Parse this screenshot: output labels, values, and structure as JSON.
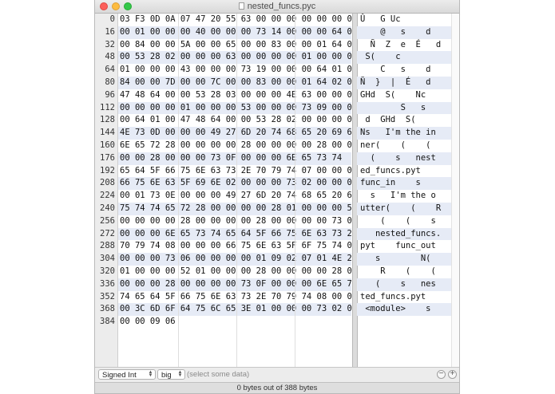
{
  "window": {
    "title": "nested_funcs.pyc"
  },
  "offsets": [
    "0",
    "16",
    "32",
    "48",
    "64",
    "80",
    "96",
    "112",
    "128",
    "144",
    "160",
    "176",
    "192",
    "208",
    "224",
    "240",
    "256",
    "272",
    "288",
    "304",
    "320",
    "336",
    "352",
    "368",
    "384"
  ],
  "hex_rows": [
    "03 F3 0D 0A 07 47 20 55 63 00 00 00 00 00 00 00",
    "00 01 00 00 00 40 00 00 00 73 14 00 00 00 64 00",
    "00 84 00 00 5A 00 00 65 00 00 83 00 00 01 64 01",
    "00 53 28 02 00 00 00 63 00 00 00 00 01 00 00 00",
    "01 00 00 00 43 00 00 00 73 19 00 00 00 64 01 00",
    "84 00 00 7D 00 00 7C 00 00 83 00 00 01 64 02 00",
    "47 48 64 00 00 53 28 03 00 00 00 4E 63 00 00 00",
    "00 00 00 00 01 00 00 00 53 00 00 00 73 09 00 00",
    "00 64 01 00 47 48 64 00 00 53 28 02 00 00 00 00",
    "4E 73 0D 00 00 00 49 27 6D 20 74 68 65 20 69 6E",
    "6E 65 72 28 00 00 00 00 28 00 00 00 00 28 00 00",
    "00 00 28 00 00 00 73 0F 00 00 00 6E 65 73 74",
    "65 64 5F 66 75 6E 63 73 2E 70 79 74 07 00 00 00",
    "66 75 6E 63 5F 69 6E 02 00 00 00 73 02 00 00 00",
    "00 01 73 0E 00 00 00 49 27 6D 20 74 68 65 20 6F",
    "75 74 74 65 72 28 00 00 00 00 28 01 00 00 00 52",
    "00 00 00 00 28 00 00 00 00 28 00 00 00 00 73 0F",
    "00 00 00 6E 65 73 74 65 64 5F 66 75 6E 63 73 2E",
    "70 79 74 08 00 00 00 66 75 6E 63 5F 6F 75 74 01",
    "00 00 00 73 06 00 00 00 00 01 09 02 07 01 4E 28",
    "01 00 00 00 52 01 00 00 00 28 00 00 00 00 28 00",
    "00 00 00 28 00 00 00 00 73 0F 00 00 00 6E 65 73",
    "74 65 64 5F 66 75 6E 63 73 2E 70 79 74 08 00 00",
    "00 3C 6D 6F 64 75 6C 65 3E 01 00 00 00 73 02 00",
    "00 00 09 06"
  ],
  "ascii_rows": [
    "Û   G Uc",
    "    @   s    d",
    "  Ñ  Z  e  É   d",
    " S(    c",
    "    C   s    d",
    "Ñ  }  |  É   d",
    "GHd  S(    Nc",
    "        S   s",
    " d  GHd  S(",
    "Ns   I'm the in",
    "ner(    (    (",
    "  (    s   nest",
    "ed_funcs.pyt",
    "func_in    s",
    "  s   I'm the o",
    "utter(    (    R",
    "    (    (    s",
    "   nested_funcs.",
    "pyt    func_out",
    "   s        N(",
    "    R    (    (",
    "   (    s   nes",
    "ted_funcs.pyt",
    " <module>    s",
    ""
  ],
  "controls": {
    "type_select": "Signed Int",
    "endian_select": "big",
    "selection_hint": "(select some data)",
    "minus_label": "−",
    "plus_label": "+"
  },
  "status": {
    "text": "0 bytes out of 388 bytes"
  },
  "colors": {
    "alt_row": "#e6ebf6",
    "close": "#fc605b",
    "minimize": "#fdbc40",
    "zoom": "#34c84a"
  }
}
